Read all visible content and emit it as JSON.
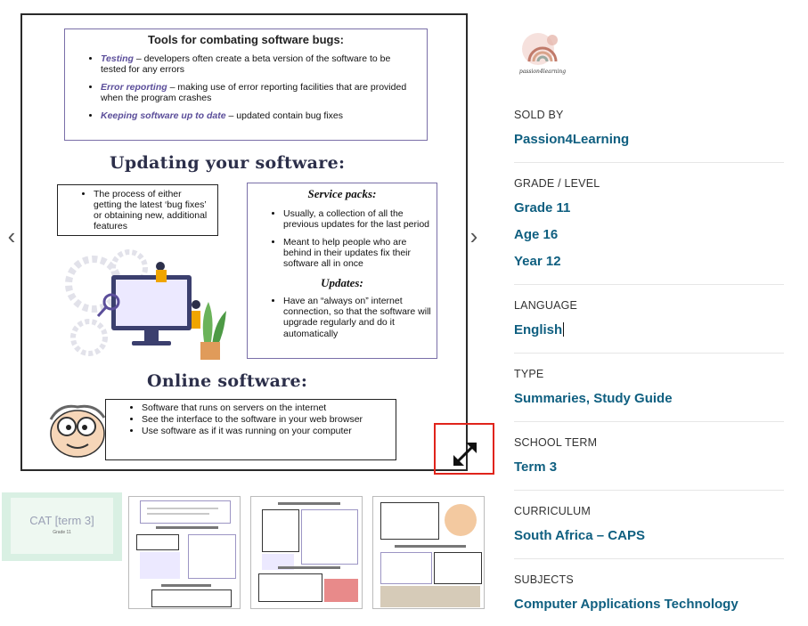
{
  "preview": {
    "tools_title": "Tools for combating software bugs:",
    "tools": [
      {
        "term": "Testing",
        "text": " – developers often create a beta version of the software to be tested for any errors"
      },
      {
        "term": "Error reporting",
        "text": " – making use of error reporting facilities that are provided when the program crashes"
      },
      {
        "term": "Keeping software up to date",
        "text": " – updated contain bug fixes"
      }
    ],
    "updating_title": "Updating your software:",
    "process_text": "The process of either getting the latest ‘bug fixes’ or obtaining new, additional features",
    "service_title": "Service packs:",
    "service_items": [
      "Usually, a collection of all the previous updates for the last period",
      "Meant to help people who are behind in their updates fix their software all in once"
    ],
    "updates_title": "Updates:",
    "updates_items": [
      "Have an “always on” internet connection, so that the software will upgrade regularly and do it automatically"
    ],
    "online_title": "Online software:",
    "online_items": [
      "Software that runs on servers on the internet",
      "See the interface to the software in your web browser",
      "Use software as if it was running on your computer"
    ]
  },
  "icons": {
    "prev": "chevron-left-icon",
    "next": "chevron-right-icon",
    "expand": "expand-arrows-icon"
  },
  "thumbs": {
    "first_title": "CAT [term 3]",
    "first_sub": "Grade 11",
    "first_bg": "#d9f0e3"
  },
  "seller": {
    "logo_text": "passion4learning",
    "sold_by_label": "SOLD BY",
    "sold_by": "Passion4Learning"
  },
  "grade": {
    "label": "GRADE / LEVEL",
    "items": [
      "Grade 11",
      "Age 16",
      "Year 12"
    ]
  },
  "language": {
    "label": "LANGUAGE",
    "value": "English"
  },
  "type": {
    "label": "TYPE",
    "value": "Summaries, Study Guide"
  },
  "term": {
    "label": "SCHOOL TERM",
    "value": "Term 3"
  },
  "curriculum": {
    "label": "CURRICULUM",
    "value": "South Africa – CAPS"
  },
  "subjects": {
    "label": "SUBJECTS",
    "value": "Computer Applications Technology"
  },
  "colors": {
    "link": "#0f5f80",
    "highlight": "#e0241b",
    "accent": "#7a6fa8"
  }
}
